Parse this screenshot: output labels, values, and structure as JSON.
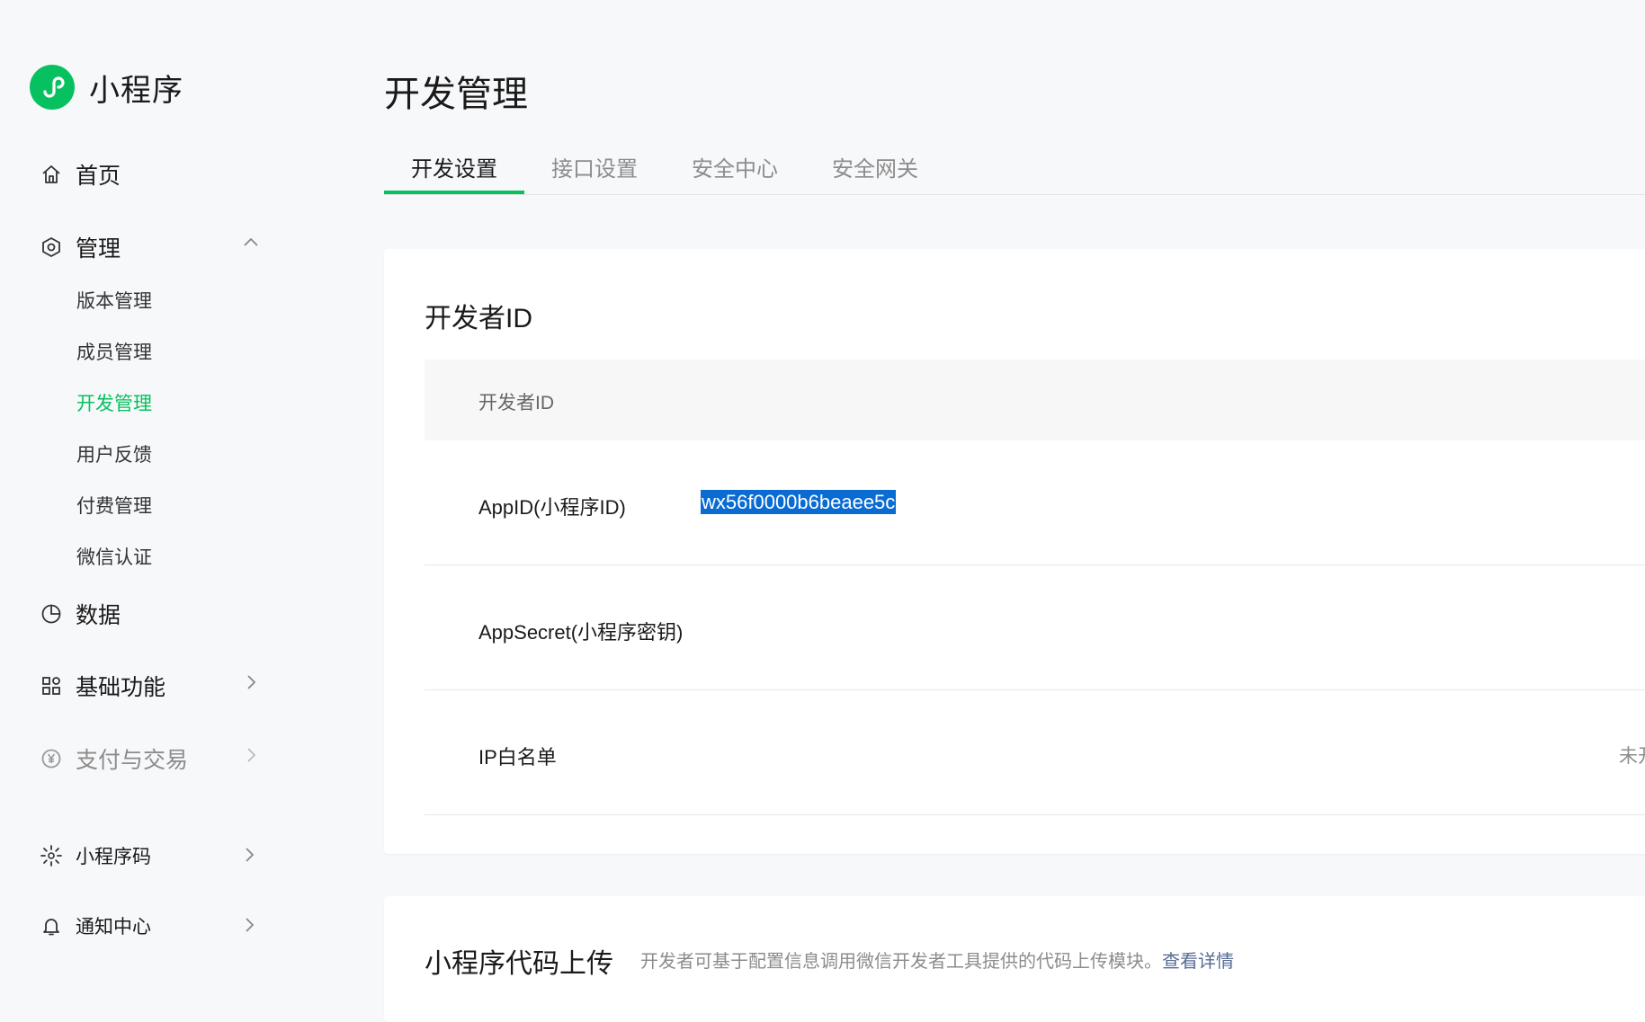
{
  "app": {
    "name": "小程序",
    "accent": "#07c160"
  },
  "sidebar": {
    "home": {
      "label": "首页",
      "icon": "home-icon"
    },
    "manage": {
      "label": "管理",
      "icon": "settings-hex-icon",
      "children": [
        "版本管理",
        "成员管理",
        "开发管理",
        "用户反馈",
        "付费管理",
        "微信认证"
      ],
      "active": "开发管理"
    },
    "data": {
      "label": "数据",
      "icon": "pie-chart-icon"
    },
    "basic": {
      "label": "基础功能",
      "icon": "grid-icon"
    },
    "pay": {
      "label": "支付与交易",
      "icon": "yuan-icon"
    },
    "qrcode": {
      "label": "小程序码",
      "icon": "sun-code-icon"
    },
    "notify": {
      "label": "通知中心",
      "icon": "bell-icon"
    }
  },
  "main": {
    "title": "开发管理",
    "tabs": [
      "开发设置",
      "接口设置",
      "安全中心",
      "安全网关"
    ],
    "active_tab": "开发设置",
    "dev_id": {
      "title": "开发者ID",
      "header": "开发者ID",
      "rows": [
        {
          "label": "AppID(小程序ID)",
          "value": "wx56f0000b6beaee5c"
        },
        {
          "label": "AppSecret(小程序密钥)",
          "value": ""
        },
        {
          "label": "IP白名单",
          "status": "未开"
        }
      ]
    },
    "upload": {
      "title": "小程序代码上传",
      "desc": "开发者可基于配置信息调用微信开发者工具提供的代码上传模块。",
      "link": "查看详情"
    }
  }
}
